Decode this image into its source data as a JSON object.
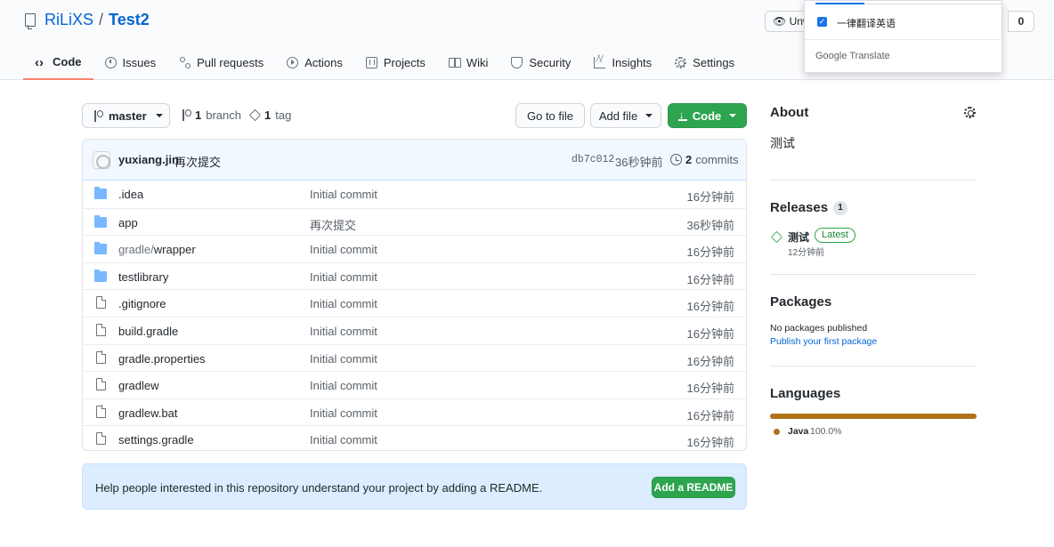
{
  "repo": {
    "owner": "RiLiXS",
    "separator": "/",
    "name": "Test2"
  },
  "header_buttons": {
    "watch_label": "Unw",
    "star_count": "0"
  },
  "tabs": [
    {
      "label": "Code",
      "icon": "code-icon",
      "selected": true
    },
    {
      "label": "Issues",
      "icon": "issue-icon",
      "selected": false
    },
    {
      "label": "Pull requests",
      "icon": "pull-request-icon",
      "selected": false
    },
    {
      "label": "Actions",
      "icon": "play-icon",
      "selected": false
    },
    {
      "label": "Projects",
      "icon": "project-board-icon",
      "selected": false
    },
    {
      "label": "Wiki",
      "icon": "book-icon",
      "selected": false
    },
    {
      "label": "Security",
      "icon": "shield-icon",
      "selected": false
    },
    {
      "label": "Insights",
      "icon": "graph-icon",
      "selected": false
    },
    {
      "label": "Settings",
      "icon": "gear-icon",
      "selected": false
    }
  ],
  "translate_popup": {
    "checkbox_label": "一律翻译英语",
    "checked": true,
    "brand": "Google",
    "brand_suffix": "Translate"
  },
  "toolbar": {
    "branch_name": "master",
    "branch_count": "1",
    "branch_label": "branch",
    "tag_count": "1",
    "tag_label": "tag",
    "goto_file": "Go to file",
    "add_file": "Add file",
    "code": "Code"
  },
  "latest_commit": {
    "author": "yuxiang.jin",
    "message": "再次提交",
    "sha": "db7c012",
    "time": "36秒钟前",
    "commit_count": "2",
    "commit_label": "commits"
  },
  "files": [
    {
      "type": "dir",
      "name": ".idea",
      "name_muted": "",
      "message": "Initial commit",
      "age": "16分钟前"
    },
    {
      "type": "dir",
      "name": "app",
      "name_muted": "",
      "message": "再次提交",
      "age": "36秒钟前"
    },
    {
      "type": "dir",
      "name": "wrapper",
      "name_muted": "gradle/",
      "message": "Initial commit",
      "age": "16分钟前"
    },
    {
      "type": "dir",
      "name": "testlibrary",
      "name_muted": "",
      "message": "Initial commit",
      "age": "16分钟前"
    },
    {
      "type": "file",
      "name": ".gitignore",
      "name_muted": "",
      "message": "Initial commit",
      "age": "16分钟前"
    },
    {
      "type": "file",
      "name": "build.gradle",
      "name_muted": "",
      "message": "Initial commit",
      "age": "16分钟前"
    },
    {
      "type": "file",
      "name": "gradle.properties",
      "name_muted": "",
      "message": "Initial commit",
      "age": "16分钟前"
    },
    {
      "type": "file",
      "name": "gradlew",
      "name_muted": "",
      "message": "Initial commit",
      "age": "16分钟前"
    },
    {
      "type": "file",
      "name": "gradlew.bat",
      "name_muted": "",
      "message": "Initial commit",
      "age": "16分钟前"
    },
    {
      "type": "file",
      "name": "settings.gradle",
      "name_muted": "",
      "message": "Initial commit",
      "age": "16分钟前"
    }
  ],
  "readme_prompt": {
    "text": "Help people interested in this repository understand your project by adding a README.",
    "button": "Add a README"
  },
  "sidebar": {
    "about_title": "About",
    "about_desc": "测试",
    "releases_title": "Releases",
    "releases_count": "1",
    "release_name": "测试",
    "release_badge": "Latest",
    "release_time": "12分钟前",
    "packages_title": "Packages",
    "packages_none": "No packages published",
    "packages_link": "Publish your first package",
    "languages_title": "Languages",
    "language_name": "Java",
    "language_pct": "100.0%",
    "language_color": "#b07219"
  },
  "colors": {
    "link": "#0366d6",
    "primary_button": "#2ea44f",
    "selected_tab_underline": "#f9826c",
    "folder": "#79b8ff"
  }
}
